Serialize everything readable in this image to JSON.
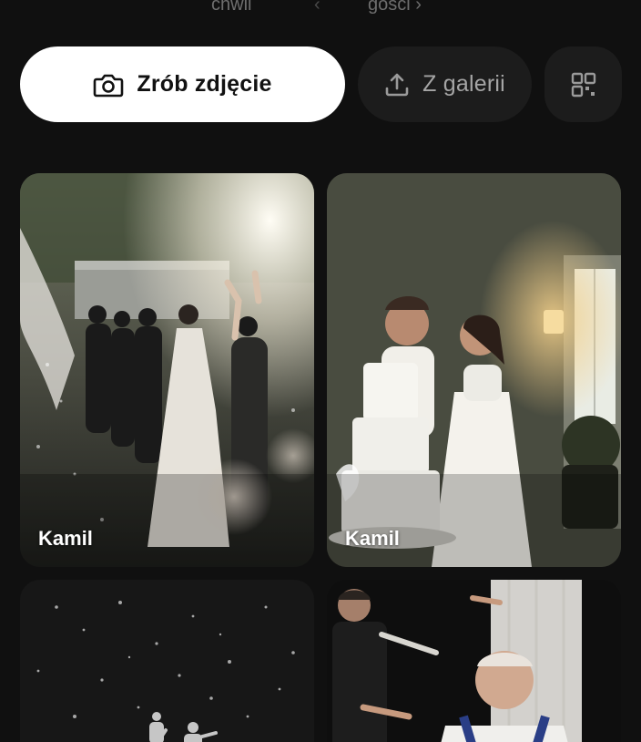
{
  "top_tabs": {
    "left_label": "chwil",
    "right_label": "gości ›"
  },
  "actions": {
    "camera_label": "Zrób zdjęcie",
    "gallery_label": "Z galerii",
    "camera_icon": "camera-icon",
    "gallery_icon": "upload-icon",
    "qr_icon": "qr-code-icon"
  },
  "colors": {
    "background": "#101010",
    "primary_button": "#ffffff",
    "secondary_button": "#1c1c1c"
  },
  "photos": [
    {
      "author": "Kamil"
    },
    {
      "author": "Kamil"
    },
    {
      "author": ""
    },
    {
      "author": ""
    }
  ]
}
